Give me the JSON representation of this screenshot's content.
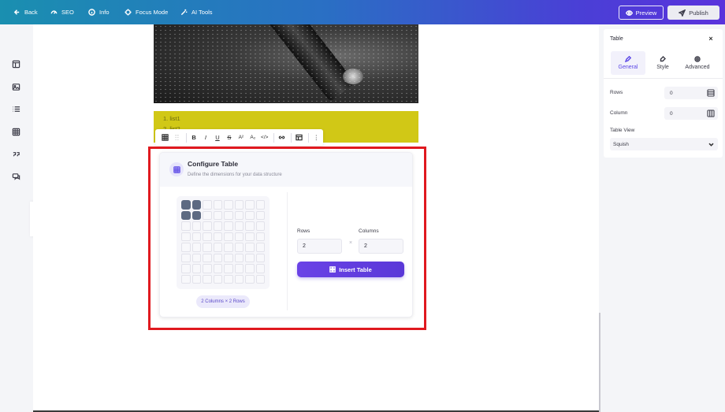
{
  "topbar": {
    "back": "Back",
    "seo": "SEO",
    "info": "Info",
    "focus_mode": "Focus Mode",
    "ai_tools": "AI Tools",
    "preview": "Preview",
    "publish": "Publish"
  },
  "left_rail": {
    "icons": [
      "layout-icon",
      "image-icon",
      "list-icon",
      "table-icon",
      "quote-icon",
      "chat-icon"
    ]
  },
  "editor": {
    "list_items": [
      "list1",
      "list2"
    ],
    "format_toolbar": {
      "bold": "B",
      "italic": "I",
      "underline": "U",
      "strike": "S",
      "superscript": "A²",
      "subscript": "A₂",
      "code": "</>",
      "more": "⋮"
    }
  },
  "configure_table": {
    "title": "Configure Table",
    "subtitle": "Define the dimensions for your data structure",
    "grid_rows": 8,
    "grid_cols": 8,
    "selected_rows": 2,
    "selected_cols": 2,
    "size_label": "2 Columns × 2 Rows",
    "rows_label": "Rows",
    "columns_label": "Columns",
    "rows_value": "2",
    "columns_value": "2",
    "times": "×",
    "insert_button": "Insert Table",
    "accent_color": "#5c48e6"
  },
  "right_panel": {
    "title": "Table",
    "close": "×",
    "tabs": {
      "general": "General",
      "style": "Style",
      "advanced": "Advanced"
    },
    "rows_label": "Rows",
    "rows_value": "0",
    "column_label": "Column",
    "column_value": "0",
    "table_view_label": "Table View",
    "table_view_value": "Squish"
  }
}
